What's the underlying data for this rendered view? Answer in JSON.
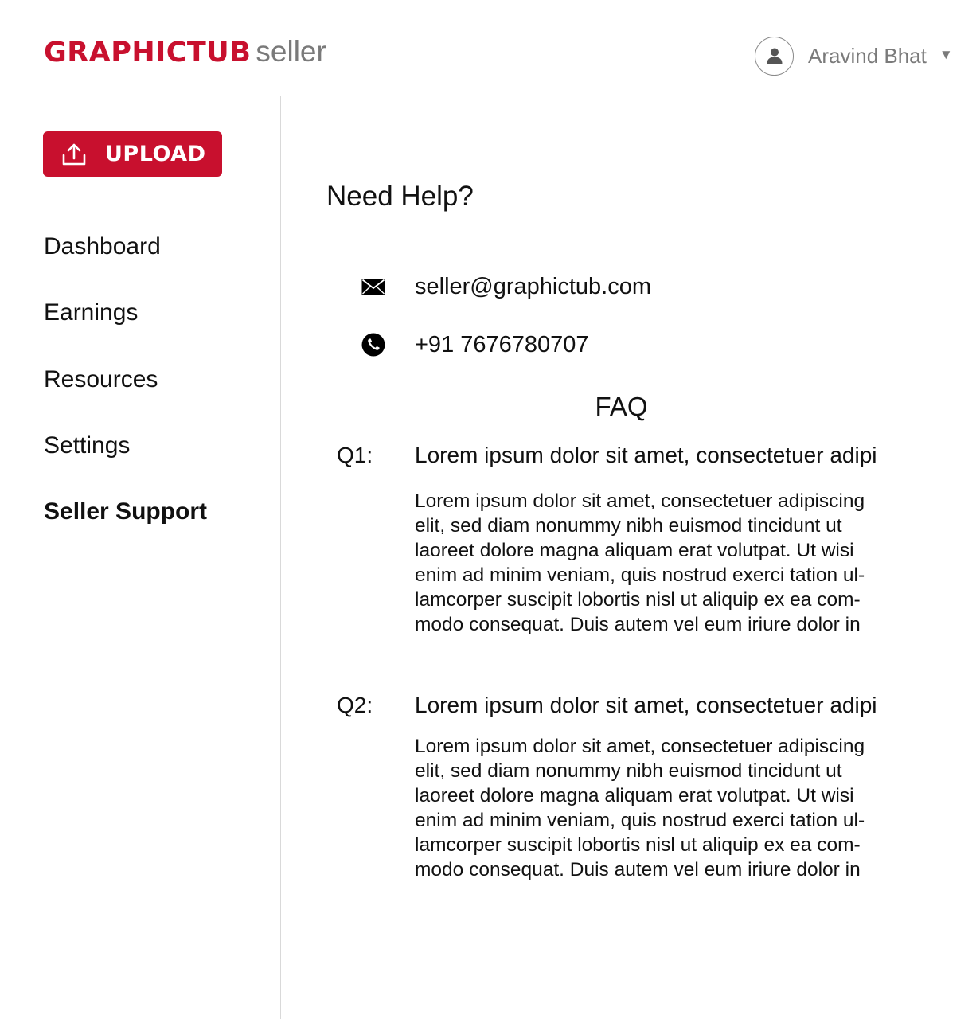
{
  "header": {
    "brand": "GRAPHICTUB",
    "brand_suffix": "seller",
    "user_name": "Aravind Bhat",
    "caret": "▼"
  },
  "sidebar": {
    "upload_label": "UPLOAD",
    "items": [
      {
        "label": "Dashboard",
        "active": false
      },
      {
        "label": "Earnings",
        "active": false
      },
      {
        "label": "Resources",
        "active": false
      },
      {
        "label": "Settings",
        "active": false
      },
      {
        "label": "Seller Support",
        "active": true
      }
    ]
  },
  "main": {
    "title": "Need Help?",
    "email": "seller@graphictub.com",
    "phone": "+91 7676780707",
    "faq_title": "FAQ",
    "faqs": [
      {
        "num": "Q1:",
        "question": "Lorem ipsum dolor sit amet, consectetuer adipi",
        "answer": "Lorem ipsum dolor sit amet, consectetuer adipiscing elit, sed diam nonummy nibh euismod tincidunt ut laoreet dolore magna aliquam erat volutpat. Ut wisi enim ad minim veniam, quis nostrud exerci tation ul-lamcorper suscipit lobortis nisl ut aliquip ex ea com-modo consequat. Duis autem vel eum iriure dolor in"
      },
      {
        "num": "Q2:",
        "question": "Lorem ipsum dolor sit amet, consectetuer adipi",
        "answer": "Lorem ipsum dolor sit amet, consectetuer adipiscing elit, sed diam nonummy nibh euismod tincidunt ut laoreet dolore magna aliquam erat volutpat. Ut wisi enim ad minim veniam, quis nostrud exerci tation ul-lamcorper suscipit lobortis nisl ut aliquip ex ea com-modo consequat. Duis autem vel eum iriure dolor in"
      }
    ]
  },
  "icons": {
    "upload": "upload-icon",
    "avatar": "user-icon",
    "email": "envelope-icon",
    "phone": "phone-icon"
  },
  "colors": {
    "brand": "#c8102e",
    "muted": "#7a7a7a",
    "divider": "#d9d9d9"
  }
}
